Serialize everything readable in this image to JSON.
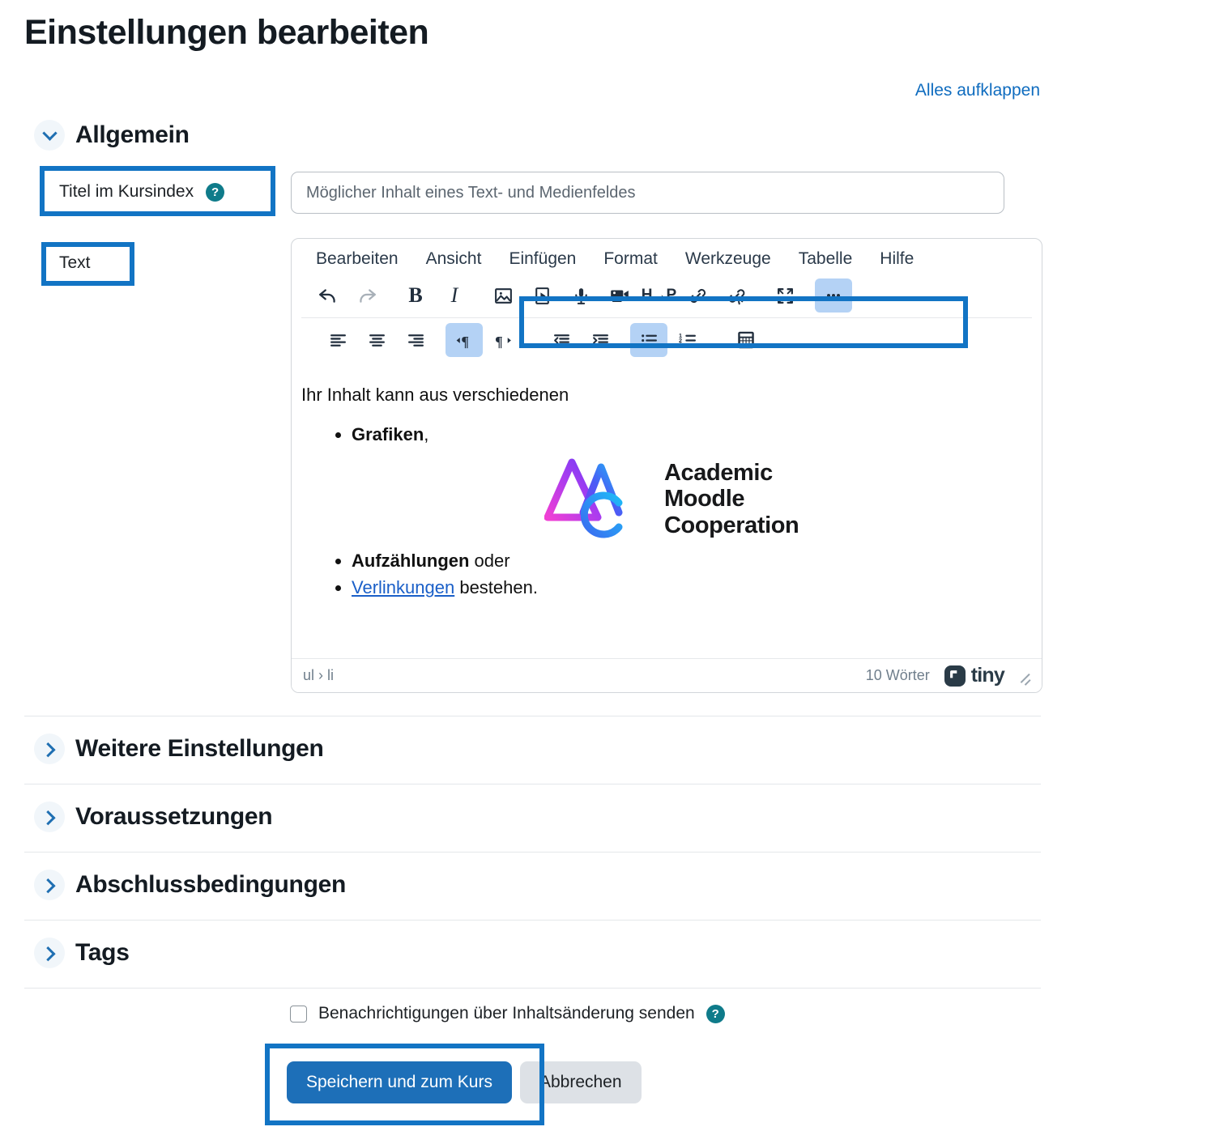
{
  "page": {
    "title": "Einstellungen bearbeiten",
    "expand_all_label": "Alles aufklappen"
  },
  "sections": [
    {
      "id": "allgemein",
      "label": "Allgemein",
      "expanded": true,
      "chevron": "chevron-down-icon"
    },
    {
      "id": "weitere-einstellungen",
      "label": "Weitere Einstellungen",
      "expanded": false,
      "chevron": "chevron-right-icon"
    },
    {
      "id": "voraussetzungen",
      "label": "Voraussetzungen",
      "expanded": false,
      "chevron": "chevron-right-icon"
    },
    {
      "id": "abschlussbedingungen",
      "label": "Abschlussbedingungen",
      "expanded": false,
      "chevron": "chevron-right-icon"
    },
    {
      "id": "tags",
      "label": "Tags",
      "expanded": false,
      "chevron": "chevron-right-icon"
    }
  ],
  "form": {
    "title_field": {
      "label": "Titel im Kursindex",
      "help_icon": "help-circle-icon",
      "value": "",
      "placeholder": "Möglicher Inhalt eines Text- und Medienfeldes"
    },
    "text_field": {
      "label": "Text"
    }
  },
  "editor": {
    "menu": [
      "Bearbeiten",
      "Ansicht",
      "Einfügen",
      "Format",
      "Werkzeuge",
      "Tabelle",
      "Hilfe"
    ],
    "toolbar_row1": [
      {
        "name": "undo-icon",
        "state": "enabled"
      },
      {
        "name": "redo-icon",
        "state": "disabled"
      },
      {
        "name": "bold-icon",
        "state": "enabled",
        "glyph": "B"
      },
      {
        "name": "italic-icon",
        "state": "enabled",
        "glyph": "I"
      },
      {
        "name": "image-icon",
        "state": "enabled"
      },
      {
        "name": "media-player-icon",
        "state": "enabled"
      },
      {
        "name": "microphone-icon",
        "state": "enabled"
      },
      {
        "name": "video-camera-icon",
        "state": "enabled"
      },
      {
        "name": "h5p-icon",
        "state": "enabled",
        "glyph": "H-P"
      },
      {
        "name": "link-icon",
        "state": "enabled"
      },
      {
        "name": "unlink-icon",
        "state": "enabled"
      },
      {
        "name": "fullscreen-icon",
        "state": "enabled"
      },
      {
        "name": "more-options-icon",
        "state": "active"
      }
    ],
    "toolbar_row2": [
      {
        "name": "align-left-icon",
        "state": "enabled"
      },
      {
        "name": "align-center-icon",
        "state": "enabled"
      },
      {
        "name": "align-right-icon",
        "state": "enabled"
      },
      {
        "name": "ltr-direction-icon",
        "state": "active"
      },
      {
        "name": "rtl-direction-icon",
        "state": "enabled"
      },
      {
        "name": "outdent-icon",
        "state": "enabled"
      },
      {
        "name": "indent-icon",
        "state": "enabled"
      },
      {
        "name": "bullet-list-icon",
        "state": "active"
      },
      {
        "name": "numbered-list-icon",
        "state": "enabled"
      },
      {
        "name": "equation-calculator-icon",
        "state": "enabled"
      }
    ],
    "content": {
      "intro": "Ihr Inhalt kann aus verschiedenen",
      "bullet_1_bold": "Grafiken",
      "bullet_1_rest": ",",
      "logo": {
        "name": "academic-moodle-cooperation-logo",
        "line1": "Academic",
        "line2": "Moodle",
        "line3": "Cooperation"
      },
      "bullet_2_bold": "Aufzählungen",
      "bullet_2_rest": " oder",
      "bullet_3_link": "Verlinkungen",
      "bullet_3_rest": " bestehen."
    },
    "statusbar": {
      "path": "ul › li",
      "word_count": "10 Wörter",
      "brand": "tiny"
    }
  },
  "footer": {
    "notify_label": "Benachrichtigungen über Inhaltsänderung senden",
    "notify_help_icon": "help-circle-icon",
    "notify_checked": false,
    "save_label": "Speichern und zum Kurs",
    "cancel_label": "Abbrechen"
  },
  "colors": {
    "highlight_box": "#1274c4",
    "primary_button": "#1d6fb8",
    "link": "#0f6cbf",
    "help_icon": "#0f7b8a",
    "toolbar_active": "#b4d2f5"
  }
}
